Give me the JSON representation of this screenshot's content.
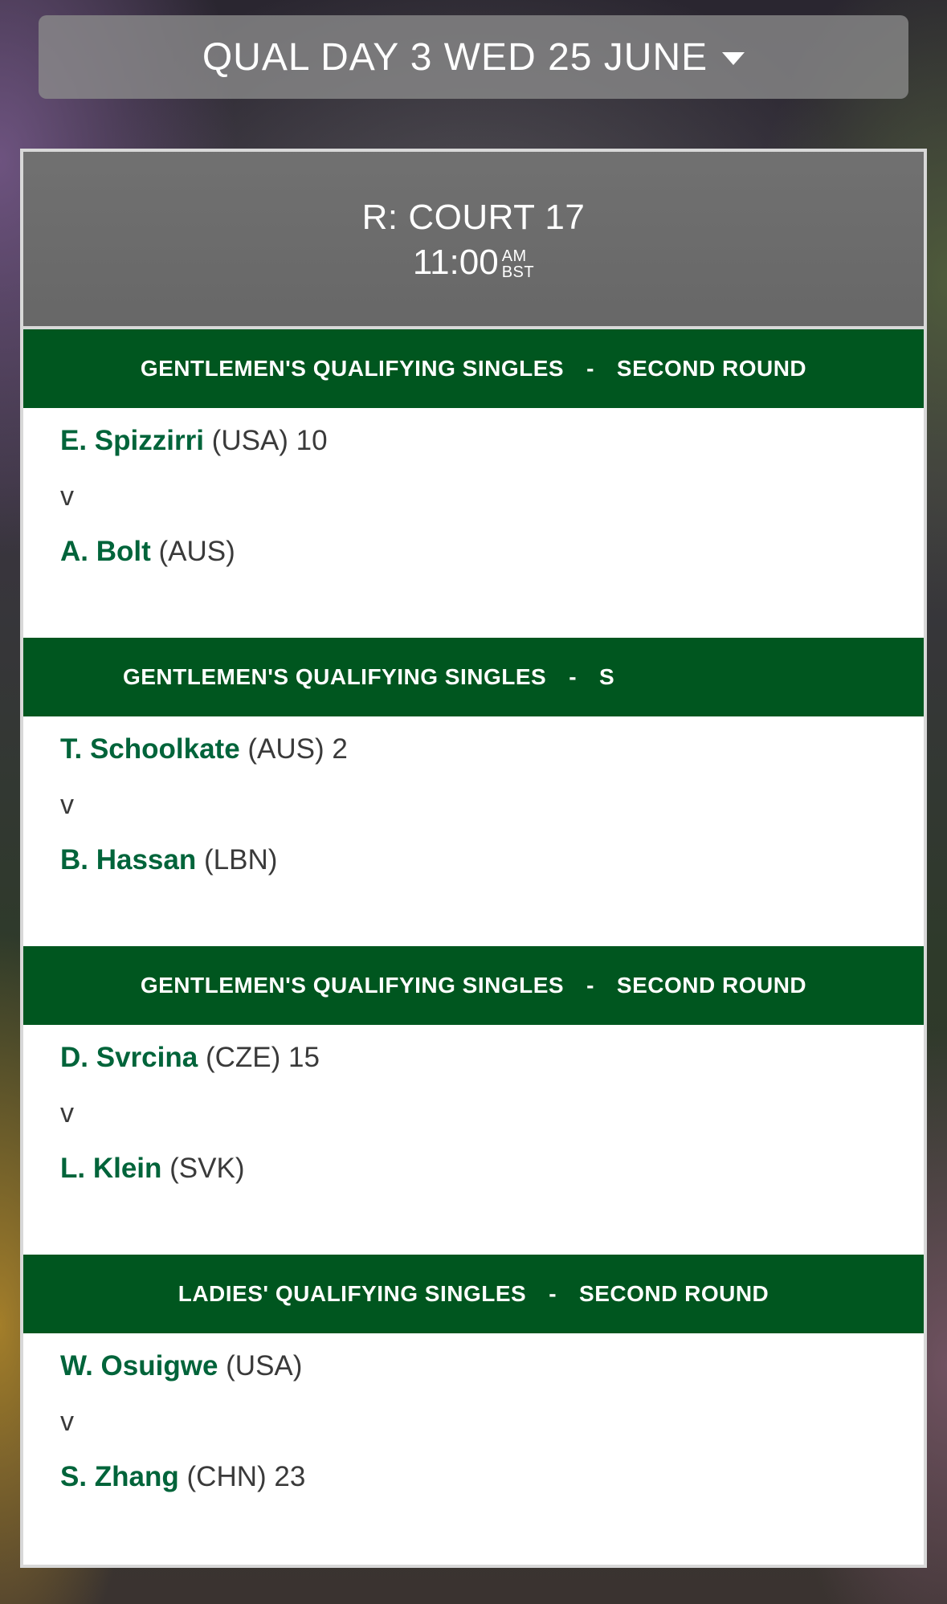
{
  "day_selector": {
    "label": "QUAL DAY 3 WED 25 JUNE"
  },
  "court": {
    "name": "R: COURT 17",
    "time": "11:00",
    "time_ampm": "AM",
    "time_zone": "BST"
  },
  "matches": [
    {
      "event": "GENTLEMEN'S QUALIFYING SINGLES",
      "separator": "-",
      "round": "SECOND ROUND",
      "player1": {
        "name": "E. Spizzirri",
        "info": "(USA) 10"
      },
      "vs": "v",
      "player2": {
        "name": "A. Bolt",
        "info": "(AUS)"
      }
    },
    {
      "event": "GENTLEMEN'S QUALIFYING SINGLES",
      "separator": "-",
      "round": "S",
      "player1": {
        "name": "T. Schoolkate",
        "info": "(AUS) 2"
      },
      "vs": "v",
      "player2": {
        "name": "B. Hassan",
        "info": "(LBN)"
      }
    },
    {
      "event": "GENTLEMEN'S QUALIFYING SINGLES",
      "separator": "-",
      "round": "SECOND ROUND",
      "player1": {
        "name": "D. Svrcina",
        "info": "(CZE) 15"
      },
      "vs": "v",
      "player2": {
        "name": "L. Klein",
        "info": "(SVK)"
      }
    },
    {
      "event": "LADIES' QUALIFYING SINGLES",
      "separator": "-",
      "round": "SECOND ROUND",
      "player1": {
        "name": "W. Osuigwe",
        "info": "(USA)"
      },
      "vs": "v",
      "player2": {
        "name": "S. Zhang",
        "info": "(CHN) 23"
      }
    }
  ],
  "colors": {
    "header_green": "#00561f",
    "player_green": "#00643a"
  }
}
